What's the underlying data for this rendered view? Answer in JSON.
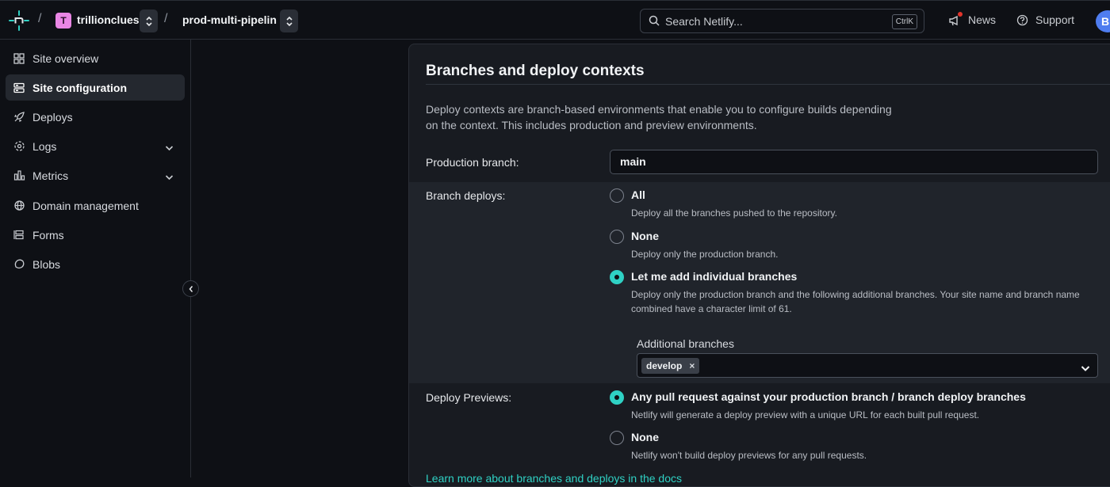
{
  "topbar": {
    "team": {
      "initial": "T",
      "name": "trillionclues"
    },
    "site_name": "prod-multi-pipelin",
    "search": {
      "placeholder": "Search Netlify...",
      "shortcut": "CtrlK"
    },
    "news_label": "News",
    "support_label": "Support",
    "avatar_initial": "B"
  },
  "sidebar": {
    "items": [
      {
        "label": "Site overview",
        "icon": "grid-icon"
      },
      {
        "label": "Site configuration",
        "icon": "server-icon",
        "active": true
      },
      {
        "label": "Deploys",
        "icon": "rocket-icon"
      },
      {
        "label": "Logs",
        "icon": "logs-icon",
        "expandable": true
      },
      {
        "label": "Metrics",
        "icon": "bar-chart-icon",
        "expandable": true
      },
      {
        "label": "Domain management",
        "icon": "globe-icon"
      },
      {
        "label": "Forms",
        "icon": "forms-icon"
      },
      {
        "label": "Blobs",
        "icon": "blob-icon"
      }
    ]
  },
  "card": {
    "title": "Branches and deploy contexts",
    "description": "Deploy contexts are branch-based environments that enable you to configure builds depending on the context. This includes production and preview environments.",
    "production_branch": {
      "label": "Production branch:",
      "value": "main"
    },
    "branch_deploys": {
      "label": "Branch deploys:",
      "options": [
        {
          "label": "All",
          "help": "Deploy all the branches pushed to the repository.",
          "checked": false
        },
        {
          "label": "None",
          "help": "Deploy only the production branch.",
          "checked": false
        },
        {
          "label": "Let me add individual branches",
          "help": "Deploy only the production branch and the following additional branches. Your site name and branch name combined have a character limit of 61.",
          "checked": true
        }
      ],
      "additional_branches": {
        "label": "Additional branches",
        "chips": [
          "develop"
        ],
        "remove_glyph": "×"
      }
    },
    "deploy_previews": {
      "label": "Deploy Previews:",
      "options": [
        {
          "label": "Any pull request against your production branch / branch deploy branches",
          "help": "Netlify will generate a deploy preview with a unique URL for each built pull request.",
          "checked": true
        },
        {
          "label": "None",
          "help": "Netlify won't build deploy previews for any pull requests.",
          "checked": false
        }
      ]
    },
    "learn_more": "Learn more about branches and deploys in the docs"
  },
  "colors": {
    "accent": "#2fd1c4",
    "background": "#0e1015",
    "card": "#181b21",
    "band": "#20242b"
  }
}
